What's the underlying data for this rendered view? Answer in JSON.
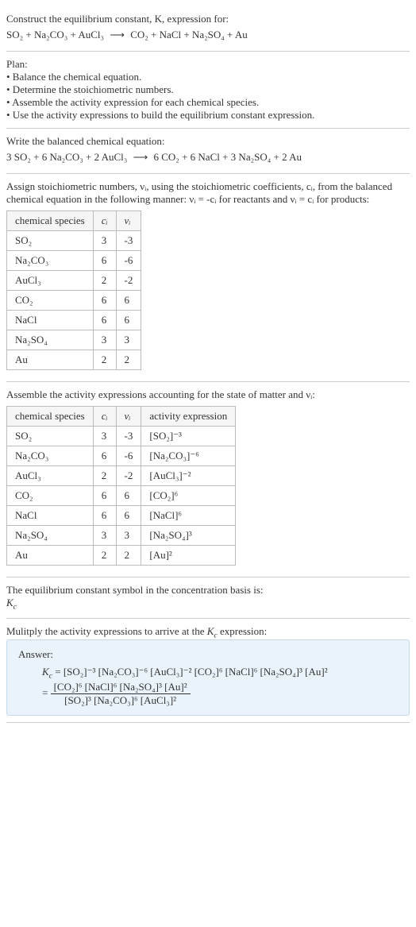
{
  "q": {
    "prompt": "Construct the equilibrium constant, K, expression for:",
    "eq_lhs": "SO₂ + Na₂CO₃ + AuCl₃",
    "eq_rhs": "CO₂ + NaCl + Na₂SO₄ + Au"
  },
  "plan": {
    "title": "Plan:",
    "b1": "• Balance the chemical equation.",
    "b2": "• Determine the stoichiometric numbers.",
    "b3": "• Assemble the activity expression for each chemical species.",
    "b4": "• Use the activity expressions to build the equilibrium constant expression."
  },
  "balanced": {
    "title": "Write the balanced chemical equation:",
    "lhs": "3 SO₂ + 6 Na₂CO₃ + 2 AuCl₃",
    "rhs": "6 CO₂ + 6 NaCl + 3 Na₂SO₄ + 2 Au"
  },
  "stoich": {
    "intro": "Assign stoichiometric numbers, νᵢ, using the stoichiometric coefficients, cᵢ, from the balanced chemical equation in the following manner: νᵢ = -cᵢ for reactants and νᵢ = cᵢ for products:",
    "h1": "chemical species",
    "h2": "cᵢ",
    "h3": "νᵢ",
    "rows": [
      {
        "sp": "SO₂",
        "c": "3",
        "v": "-3"
      },
      {
        "sp": "Na₂CO₃",
        "c": "6",
        "v": "-6"
      },
      {
        "sp": "AuCl₃",
        "c": "2",
        "v": "-2"
      },
      {
        "sp": "CO₂",
        "c": "6",
        "v": "6"
      },
      {
        "sp": "NaCl",
        "c": "6",
        "v": "6"
      },
      {
        "sp": "Na₂SO₄",
        "c": "3",
        "v": "3"
      },
      {
        "sp": "Au",
        "c": "2",
        "v": "2"
      }
    ]
  },
  "activity": {
    "intro": "Assemble the activity expressions accounting for the state of matter and νᵢ:",
    "h1": "chemical species",
    "h2": "cᵢ",
    "h3": "νᵢ",
    "h4": "activity expression",
    "rows": [
      {
        "sp": "SO₂",
        "c": "3",
        "v": "-3",
        "a": "[SO₂]⁻³"
      },
      {
        "sp": "Na₂CO₃",
        "c": "6",
        "v": "-6",
        "a": "[Na₂CO₃]⁻⁶"
      },
      {
        "sp": "AuCl₃",
        "c": "2",
        "v": "-2",
        "a": "[AuCl₃]⁻²"
      },
      {
        "sp": "CO₂",
        "c": "6",
        "v": "6",
        "a": "[CO₂]⁶"
      },
      {
        "sp": "NaCl",
        "c": "6",
        "v": "6",
        "a": "[NaCl]⁶"
      },
      {
        "sp": "Na₂SO₄",
        "c": "3",
        "v": "3",
        "a": "[Na₂SO₄]³"
      },
      {
        "sp": "Au",
        "c": "2",
        "v": "2",
        "a": "[Au]²"
      }
    ]
  },
  "basis": {
    "line1": "The equilibrium constant symbol in the concentration basis is:",
    "sym": "K",
    "sub": "c"
  },
  "final": {
    "intro": "Mulitply the activity expressions to arrive at the Kc expression:",
    "answer": "Answer:",
    "kc": "K",
    "kcsub": "c",
    "prod": "= [SO₂]⁻³ [Na₂CO₃]⁻⁶ [AuCl₃]⁻² [CO₂]⁶ [NaCl]⁶ [Na₂SO₄]³ [Au]²",
    "num": "[CO₂]⁶ [NaCl]⁶ [Na₂SO₄]³ [Au]²",
    "den": "[SO₂]³ [Na₂CO₃]⁶ [AuCl₃]²"
  }
}
